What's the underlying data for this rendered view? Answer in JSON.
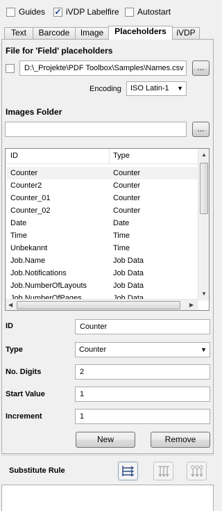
{
  "top_options": [
    {
      "label": "Guides",
      "checked": false
    },
    {
      "label": "iVDP Labelfire",
      "checked": true
    },
    {
      "label": "Autostart",
      "checked": false
    }
  ],
  "tabs": [
    "Text",
    "Barcode",
    "Image",
    "Placeholders",
    "iVDP"
  ],
  "active_tab": "Placeholders",
  "field_section": {
    "title": "File for 'Field' placeholders",
    "file_path": "D:\\_Projekte\\PDF Toolbox\\Samples\\Names.csv",
    "browse_label": "...",
    "encoding_label": "Encoding",
    "encoding_value": "ISO Latin-1"
  },
  "images_section": {
    "title": "Images Folder",
    "folder_value": "",
    "browse_label": "..."
  },
  "list": {
    "columns": [
      "ID",
      "Type"
    ],
    "rows": [
      {
        "id": "Counter",
        "type": "Counter"
      },
      {
        "id": "Counter2",
        "type": "Counter"
      },
      {
        "id": "Counter_01",
        "type": "Counter"
      },
      {
        "id": "Counter_02",
        "type": "Counter"
      },
      {
        "id": "Date",
        "type": "Date"
      },
      {
        "id": "Time",
        "type": "Time"
      },
      {
        "id": "Unbekannt",
        "type": "Time"
      },
      {
        "id": "Job.Name",
        "type": "Job Data"
      },
      {
        "id": "Job.Notifications",
        "type": "Job Data"
      },
      {
        "id": "Job.NumberOfLayouts",
        "type": "Job Data"
      },
      {
        "id": "Job.NumberOfPages",
        "type": "Job Data"
      }
    ]
  },
  "details": {
    "id_label": "ID",
    "id_value": "Counter",
    "type_label": "Type",
    "type_value": "Counter",
    "digits_label": "No. Digits",
    "digits_value": "2",
    "start_label": "Start Value",
    "start_value": "1",
    "increment_label": "Increment",
    "increment_value": "1",
    "new_label": "New",
    "remove_label": "Remove"
  },
  "substitute": {
    "title": "Substitute Rule"
  }
}
